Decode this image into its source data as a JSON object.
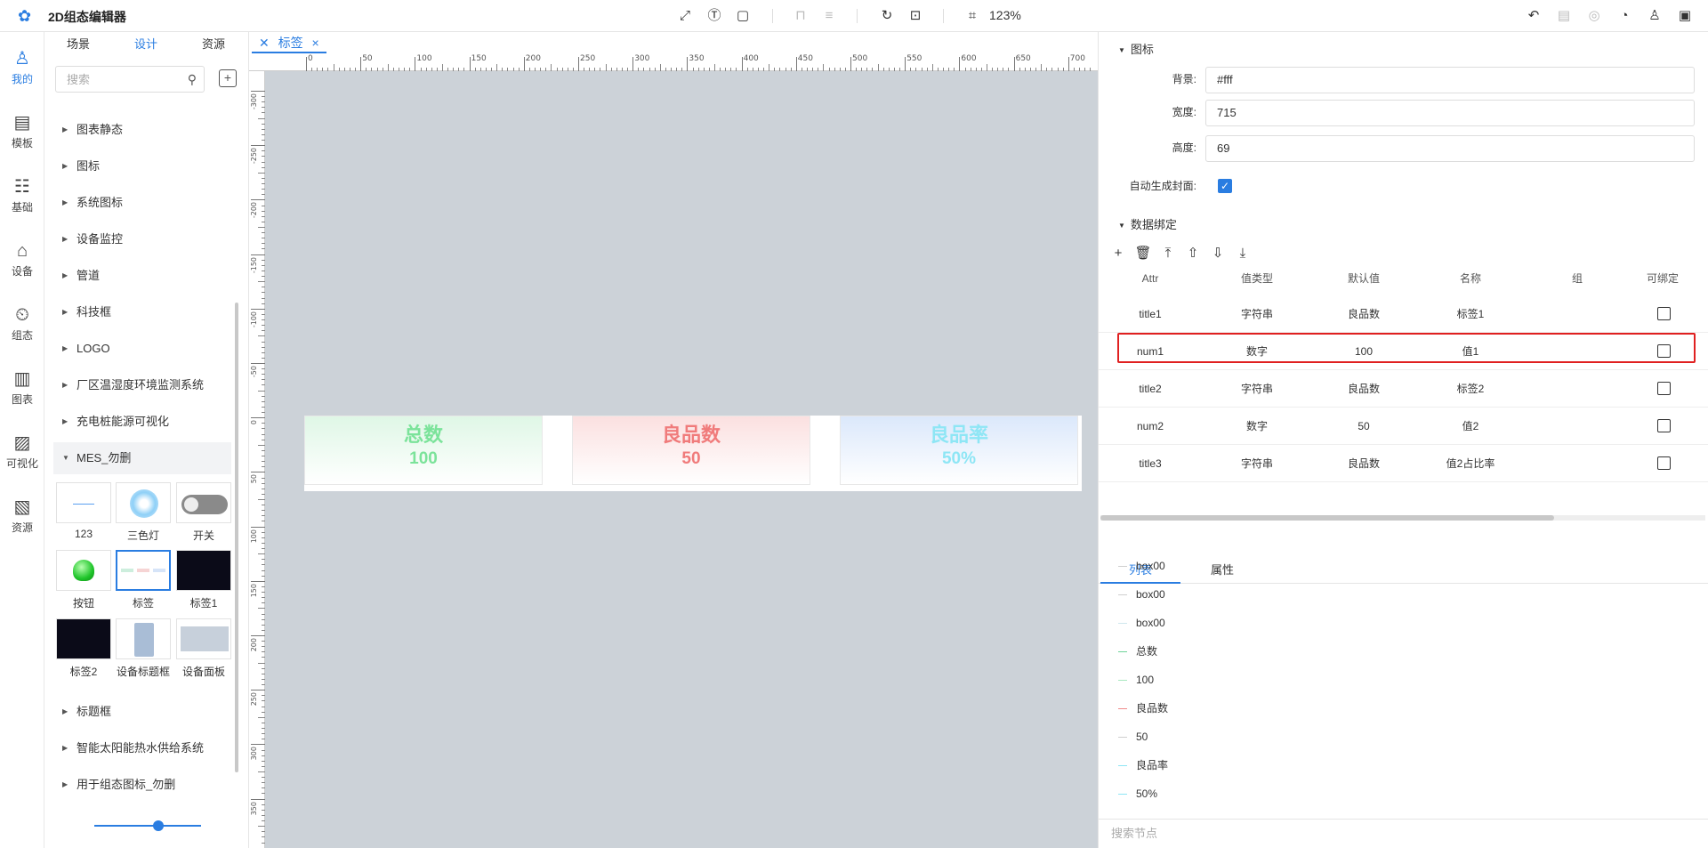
{
  "app": {
    "title": "2D组态编辑器",
    "zoom": "123%"
  },
  "rail": [
    {
      "label": "我的",
      "icon": "user-icon",
      "active": true
    },
    {
      "label": "模板",
      "icon": "template-icon"
    },
    {
      "label": "基础",
      "icon": "basic-icon"
    },
    {
      "label": "设备",
      "icon": "device-icon"
    },
    {
      "label": "组态",
      "icon": "scada-icon"
    },
    {
      "label": "图表",
      "icon": "chart-icon"
    },
    {
      "label": "可视化",
      "icon": "visualize-icon"
    },
    {
      "label": "资源",
      "icon": "resource-icon"
    }
  ],
  "library": {
    "tabs": [
      "场景",
      "设计",
      "资源"
    ],
    "active_tab": "设计",
    "search_placeholder": "搜索",
    "tree": [
      "图表静态",
      "图标",
      "系统图标",
      "设备监控",
      "管道",
      "科技框",
      "LOGO",
      "厂区温湿度环境监测系统",
      "充电桩能源可视化",
      "MES_勿删"
    ],
    "thumbs": [
      "123",
      "三色灯",
      "开关",
      "按钮",
      "标签",
      "标签1",
      "标签2",
      "设备标题框",
      "设备面板"
    ],
    "tree_after": [
      "标题框",
      "智能太阳能热水供给系统",
      "用于组态图标_勿删"
    ]
  },
  "canvas": {
    "tab_label": "标签",
    "ruler_h": [
      "0",
      "50",
      "100",
      "150",
      "200",
      "250",
      "300",
      "350",
      "400",
      "450",
      "500",
      "550",
      "600",
      "650",
      "700"
    ],
    "ruler_v": [
      "-300",
      "-250",
      "-200",
      "-150",
      "-100",
      "-50",
      "0",
      "50",
      "100",
      "150",
      "200",
      "250",
      "300",
      "350"
    ],
    "stats": [
      {
        "title": "总数",
        "value": "100",
        "color": "#7be39a",
        "bg": "#dff7e6"
      },
      {
        "title": "良品数",
        "value": "50",
        "color": "#f07b7b",
        "bg": "#fbe0e0"
      },
      {
        "title": "良品率",
        "value": "50%",
        "color": "#8ee6f5",
        "bg": "#dbe8fb"
      }
    ]
  },
  "props": {
    "section_icon": "图标",
    "bg_label": "背景:",
    "bg_value": "#fff",
    "width_label": "宽度:",
    "width_value": "715",
    "height_label": "高度:",
    "height_value": "69",
    "autocover_label": "自动生成封面:",
    "binding_section": "数据绑定",
    "columns": [
      "Attr",
      "值类型",
      "默认值",
      "名称",
      "组",
      "可绑定"
    ],
    "rows": [
      {
        "attr": "title1",
        "type": "字符串",
        "default": "良品数",
        "name": "标签1",
        "group": ""
      },
      {
        "attr": "num1",
        "type": "数字",
        "default": "100",
        "name": "值1",
        "group": ""
      },
      {
        "attr": "title2",
        "type": "字符串",
        "default": "良品数",
        "name": "标签2",
        "group": ""
      },
      {
        "attr": "num2",
        "type": "数字",
        "default": "50",
        "name": "值2",
        "group": ""
      },
      {
        "attr": "title3",
        "type": "字符串",
        "default": "良品数",
        "name": "值2占比率",
        "group": ""
      }
    ],
    "bottom_tabs": [
      "列表",
      "属性"
    ],
    "nodes": [
      {
        "label": "box00",
        "color": "#cfcfcf"
      },
      {
        "label": "box00",
        "color": "#cfcfcf"
      },
      {
        "label": "box00",
        "color": "#cfe7ee"
      },
      {
        "label": "总数",
        "color": "#6fd39a"
      },
      {
        "label": "100",
        "color": "#a8e8c0"
      },
      {
        "label": "良品数",
        "color": "#f08a8a"
      },
      {
        "label": "50",
        "color": "#cfcfcf"
      },
      {
        "label": "良品率",
        "color": "#8ee6f5"
      },
      {
        "label": "50%",
        "color": "#8ee6f5"
      }
    ],
    "node_search_placeholder": "搜索节点"
  }
}
